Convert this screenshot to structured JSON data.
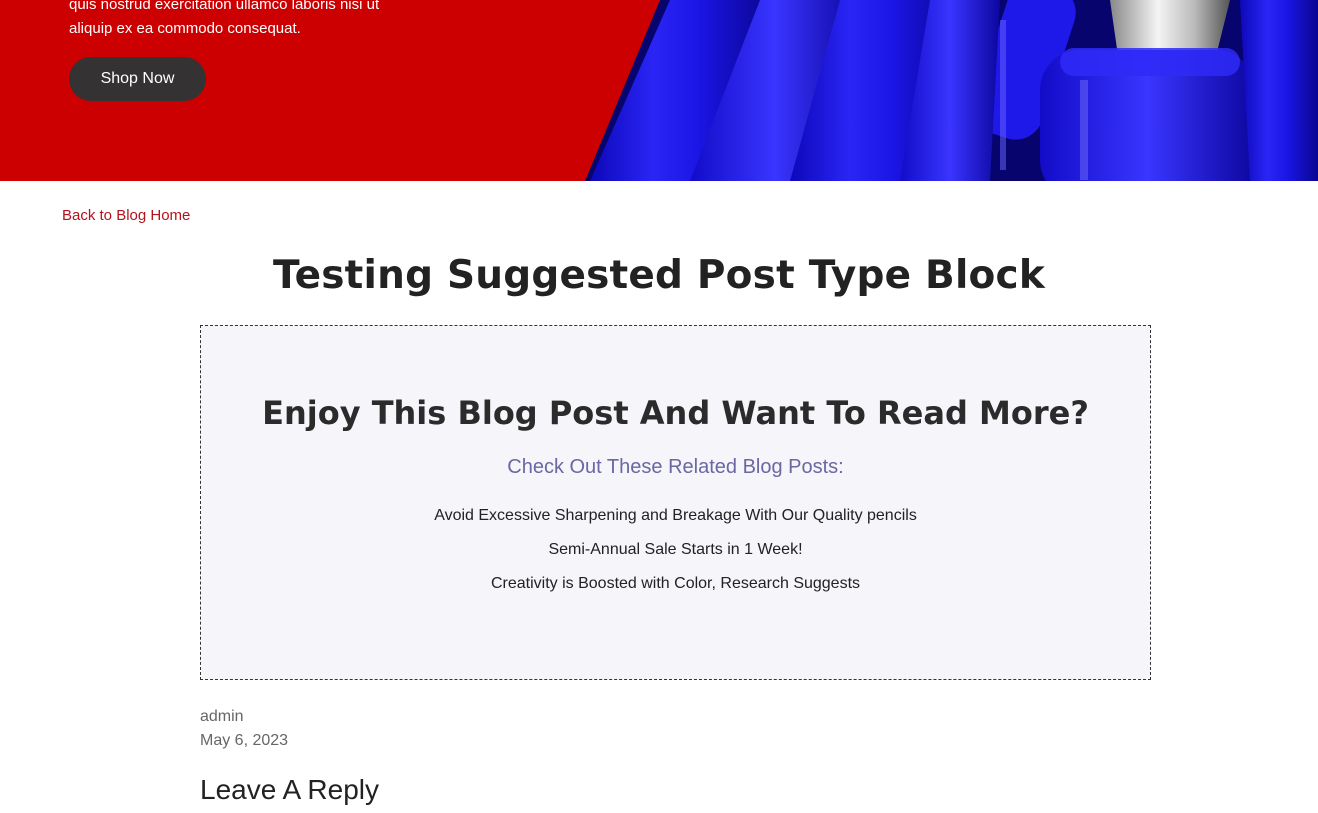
{
  "hero": {
    "text_lines": [
      "quis nostrud exercitation ullamco laboris nisi ut",
      "aliquip ex ea commodo consequat."
    ],
    "cta_label": "Shop Now",
    "colors": {
      "background": "#cc0000",
      "button": "#353233",
      "pens": "#1a14e0"
    }
  },
  "nav": {
    "back_link": "Back to Blog Home"
  },
  "post": {
    "title": "Testing Suggested Post Type Block",
    "author": "admin",
    "date": "May 6, 2023"
  },
  "suggested": {
    "heading": "Enjoy This Blog Post And Want To Read More?",
    "subheading": "Check Out These Related Blog Posts:",
    "links": [
      "Avoid Excessive Sharpening and Breakage With Our Quality pencils",
      "Semi-Annual Sale Starts in 1 Week!",
      "Creativity is Boosted with Color, Research Suggests"
    ]
  },
  "comments": {
    "heading": "Leave A Reply"
  }
}
